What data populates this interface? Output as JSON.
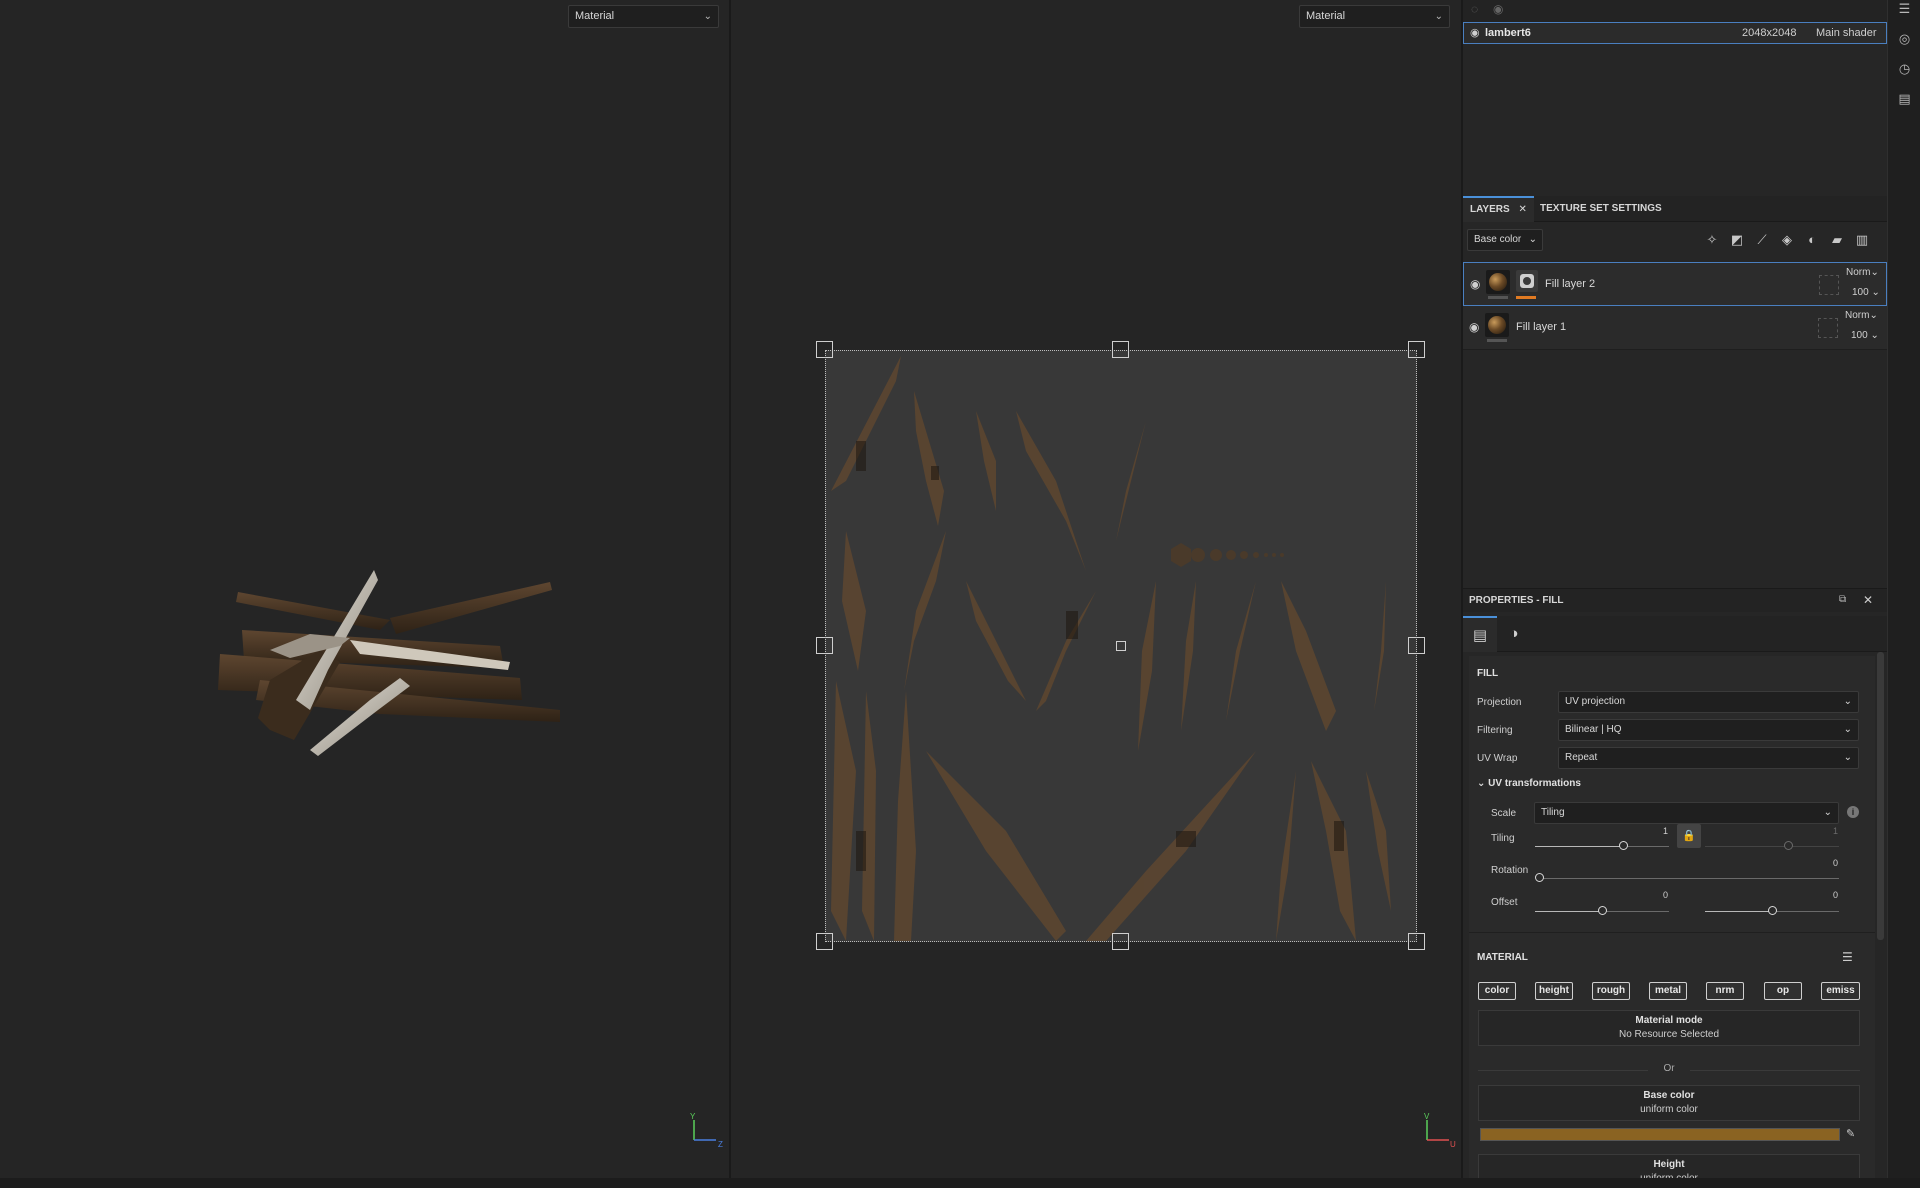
{
  "viewports": {
    "left": {
      "mode": "Material",
      "axis_y": "Y",
      "axis_z": "Z"
    },
    "right": {
      "mode": "Material",
      "axis_v": "V",
      "axis_u": "U"
    }
  },
  "texture_set": {
    "name": "lambert6",
    "resolution": "2048x2048",
    "shader": "Main shader"
  },
  "layers_panel": {
    "tabs": [
      "LAYERS",
      "TEXTURE SET SETTINGS"
    ],
    "channel": "Base color",
    "layers": [
      {
        "name": "Fill layer 2",
        "blend": "Norm",
        "opacity": "100"
      },
      {
        "name": "Fill layer 1",
        "blend": "Norm",
        "opacity": "100"
      }
    ]
  },
  "properties": {
    "title": "PROPERTIES - FILL",
    "fill": {
      "section": "FILL",
      "projection_label": "Projection",
      "projection": "UV projection",
      "filtering_label": "Filtering",
      "filtering": "Bilinear | HQ",
      "uvwrap_label": "UV Wrap",
      "uvwrap": "Repeat",
      "uv_section": "UV transformations",
      "scale_label": "Scale",
      "scale": "Tiling",
      "tiling_label": "Tiling",
      "tiling_u": "1",
      "tiling_v": "1",
      "rotation_label": "Rotation",
      "rotation": "0",
      "offset_label": "Offset",
      "offset_u": "0",
      "offset_v": "0"
    },
    "material": {
      "section": "MATERIAL",
      "channels": [
        "color",
        "height",
        "rough",
        "metal",
        "nrm",
        "op",
        "emiss"
      ],
      "mode_title": "Material mode",
      "mode_value": "No Resource Selected",
      "or": "Or",
      "base_color_title": "Base color",
      "base_color_value": "uniform color",
      "base_color_hex": "#8a6322",
      "height_title": "Height",
      "height_value": "uniform color"
    }
  }
}
